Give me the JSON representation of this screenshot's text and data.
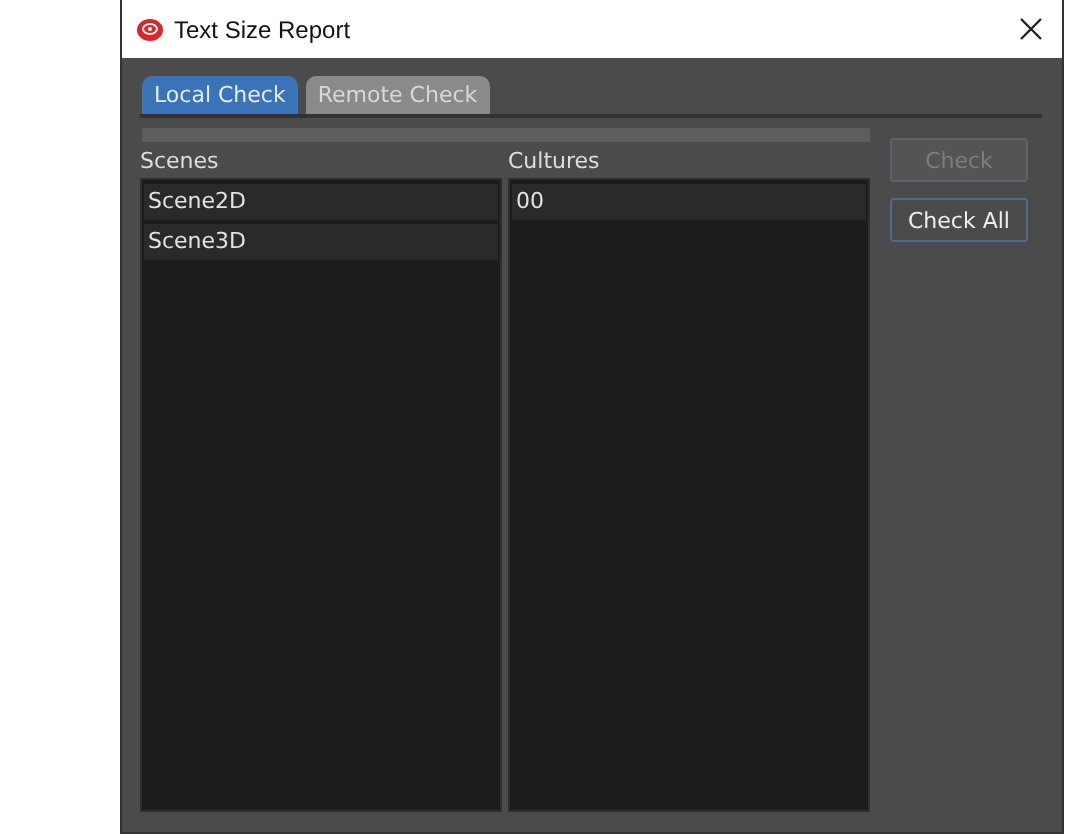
{
  "window": {
    "title": "Text Size Report"
  },
  "tabs": [
    {
      "label": "Local Check",
      "selected": true
    },
    {
      "label": "Remote Check",
      "selected": false
    }
  ],
  "scenes": {
    "heading": "Scenes",
    "items": [
      "Scene2D",
      "Scene3D"
    ]
  },
  "cultures": {
    "heading": "Cultures",
    "items": [
      "00"
    ]
  },
  "buttons": [
    {
      "label": "Check",
      "disabled": true
    },
    {
      "label": "Check All",
      "disabled": false
    }
  ]
}
